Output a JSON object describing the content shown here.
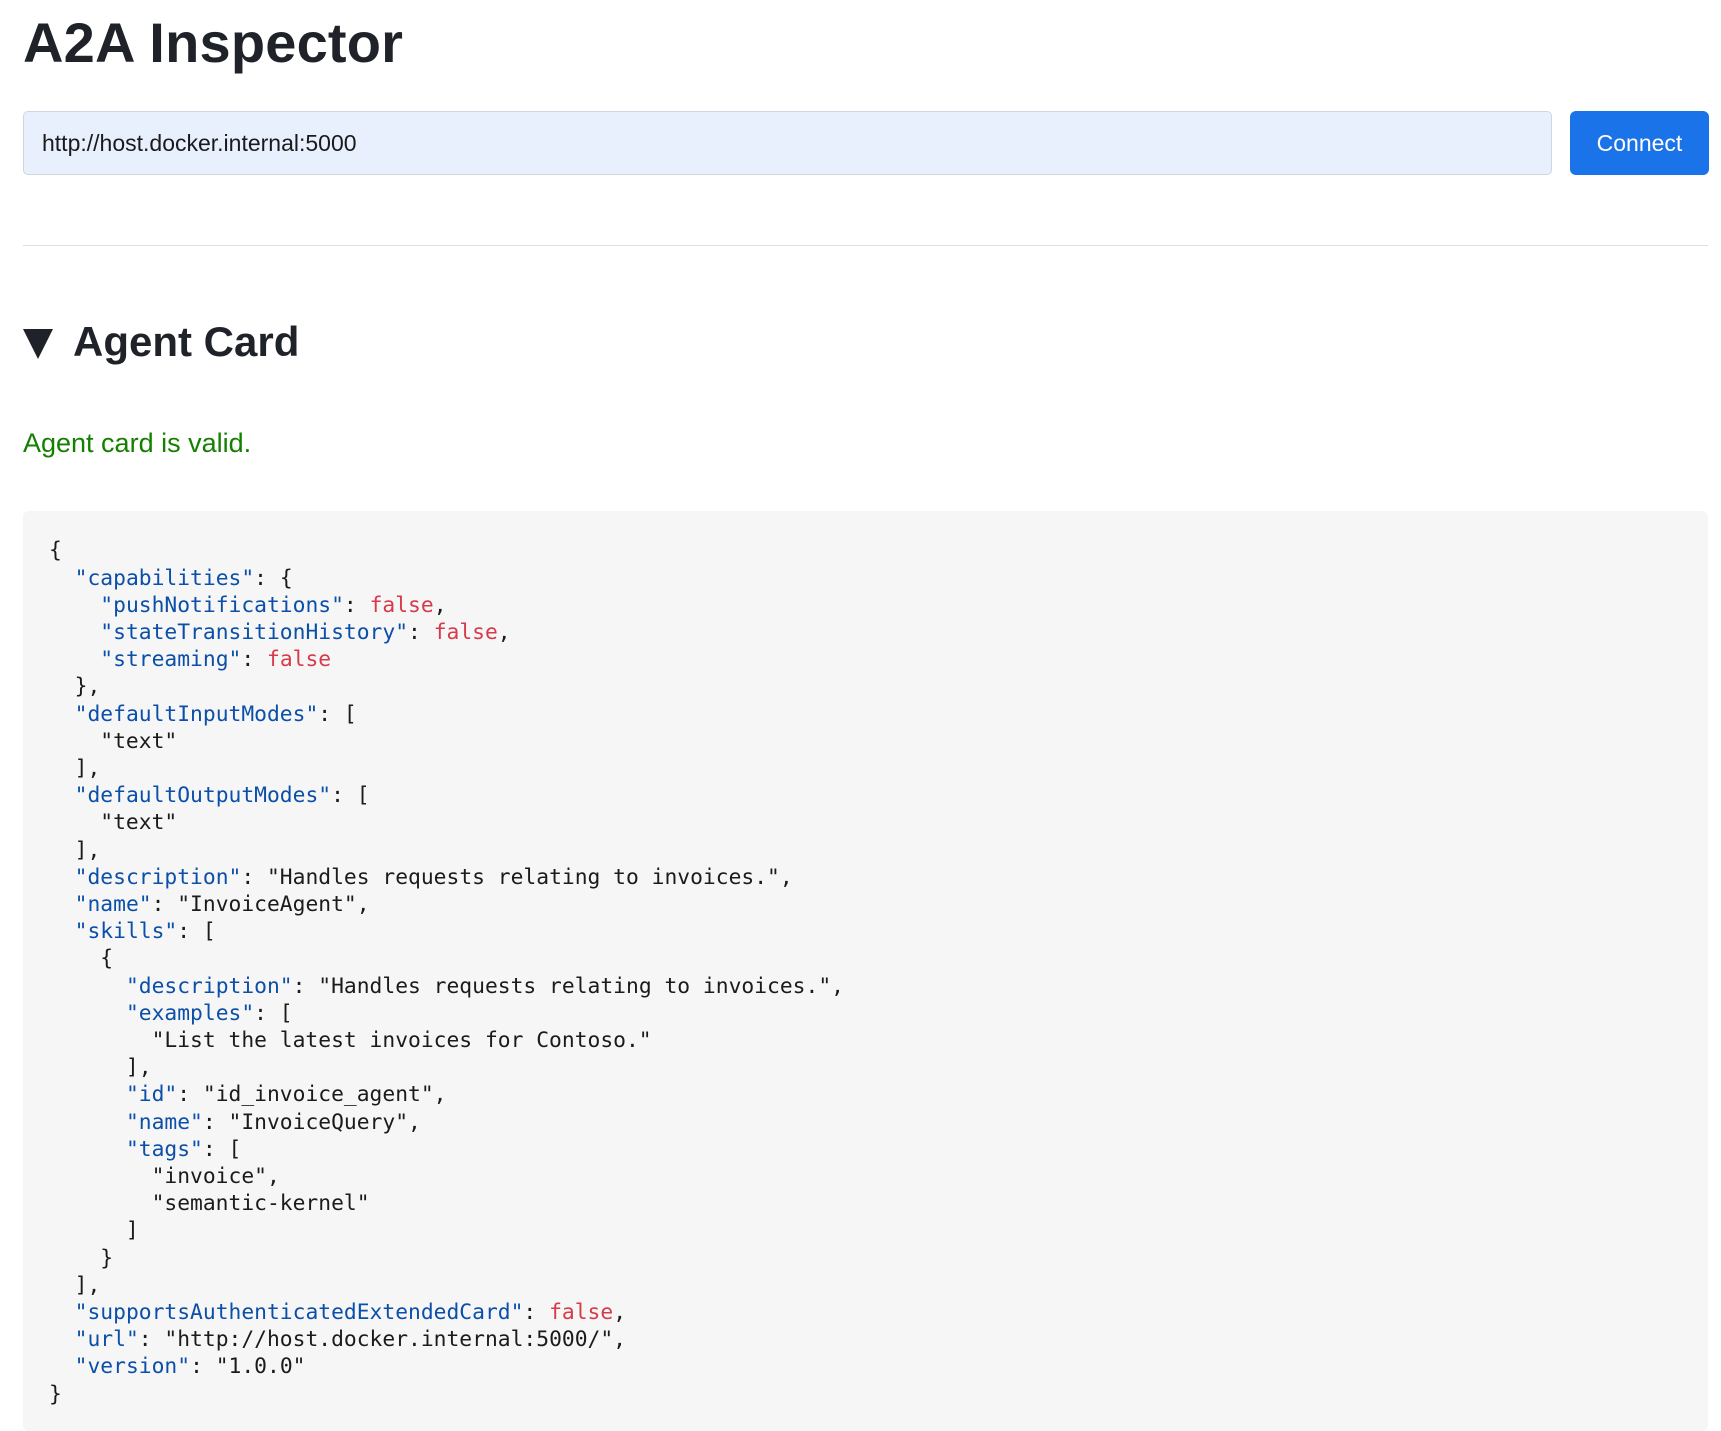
{
  "app": {
    "title": "A2A Inspector"
  },
  "connect": {
    "url_value": "http://host.docker.internal:5000",
    "button_label": "Connect"
  },
  "agent_card": {
    "toggle_symbol": "▼",
    "title": "Agent Card",
    "validation_message": "Agent card is valid.",
    "json_lines": [
      [
        {
          "t": "{"
        }
      ],
      [
        {
          "t": "  "
        },
        {
          "k": "\"capabilities\""
        },
        {
          "t": ": {"
        }
      ],
      [
        {
          "t": "    "
        },
        {
          "k": "\"pushNotifications\""
        },
        {
          "t": ": "
        },
        {
          "b": "false"
        },
        {
          "t": ","
        }
      ],
      [
        {
          "t": "    "
        },
        {
          "k": "\"stateTransitionHistory\""
        },
        {
          "t": ": "
        },
        {
          "b": "false"
        },
        {
          "t": ","
        }
      ],
      [
        {
          "t": "    "
        },
        {
          "k": "\"streaming\""
        },
        {
          "t": ": "
        },
        {
          "b": "false"
        }
      ],
      [
        {
          "t": "  },"
        }
      ],
      [
        {
          "t": "  "
        },
        {
          "k": "\"defaultInputModes\""
        },
        {
          "t": ": ["
        }
      ],
      [
        {
          "t": "    \"text\""
        }
      ],
      [
        {
          "t": "  ],"
        }
      ],
      [
        {
          "t": "  "
        },
        {
          "k": "\"defaultOutputModes\""
        },
        {
          "t": ": ["
        }
      ],
      [
        {
          "t": "    \"text\""
        }
      ],
      [
        {
          "t": "  ],"
        }
      ],
      [
        {
          "t": "  "
        },
        {
          "k": "\"description\""
        },
        {
          "t": ": \"Handles requests relating to invoices.\","
        }
      ],
      [
        {
          "t": "  "
        },
        {
          "k": "\"name\""
        },
        {
          "t": ": \"InvoiceAgent\","
        }
      ],
      [
        {
          "t": "  "
        },
        {
          "k": "\"skills\""
        },
        {
          "t": ": ["
        }
      ],
      [
        {
          "t": "    {"
        }
      ],
      [
        {
          "t": "      "
        },
        {
          "k": "\"description\""
        },
        {
          "t": ": \"Handles requests relating to invoices.\","
        }
      ],
      [
        {
          "t": "      "
        },
        {
          "k": "\"examples\""
        },
        {
          "t": ": ["
        }
      ],
      [
        {
          "t": "        \"List the latest invoices for Contoso.\""
        }
      ],
      [
        {
          "t": "      ],"
        }
      ],
      [
        {
          "t": "      "
        },
        {
          "k": "\"id\""
        },
        {
          "t": ": \"id_invoice_agent\","
        }
      ],
      [
        {
          "t": "      "
        },
        {
          "k": "\"name\""
        },
        {
          "t": ": \"InvoiceQuery\","
        }
      ],
      [
        {
          "t": "      "
        },
        {
          "k": "\"tags\""
        },
        {
          "t": ": ["
        }
      ],
      [
        {
          "t": "        \"invoice\","
        }
      ],
      [
        {
          "t": "        \"semantic-kernel\""
        }
      ],
      [
        {
          "t": "      ]"
        }
      ],
      [
        {
          "t": "    }"
        }
      ],
      [
        {
          "t": "  ],"
        }
      ],
      [
        {
          "t": "  "
        },
        {
          "k": "\"supportsAuthenticatedExtendedCard\""
        },
        {
          "t": ": "
        },
        {
          "b": "false"
        },
        {
          "t": ","
        }
      ],
      [
        {
          "t": "  "
        },
        {
          "k": "\"url\""
        },
        {
          "t": ": \"http://host.docker.internal:5000/\","
        }
      ],
      [
        {
          "t": "  "
        },
        {
          "k": "\"version\""
        },
        {
          "t": ": \"1.0.0\""
        }
      ],
      [
        {
          "t": "}"
        }
      ]
    ]
  },
  "colors": {
    "primary_button": "#1a73e8",
    "success_text": "#138000",
    "json_key": "#0b4fa8",
    "json_boolean": "#d73a49",
    "code_background": "#f6f6f6",
    "input_background": "#e8f0fe"
  }
}
